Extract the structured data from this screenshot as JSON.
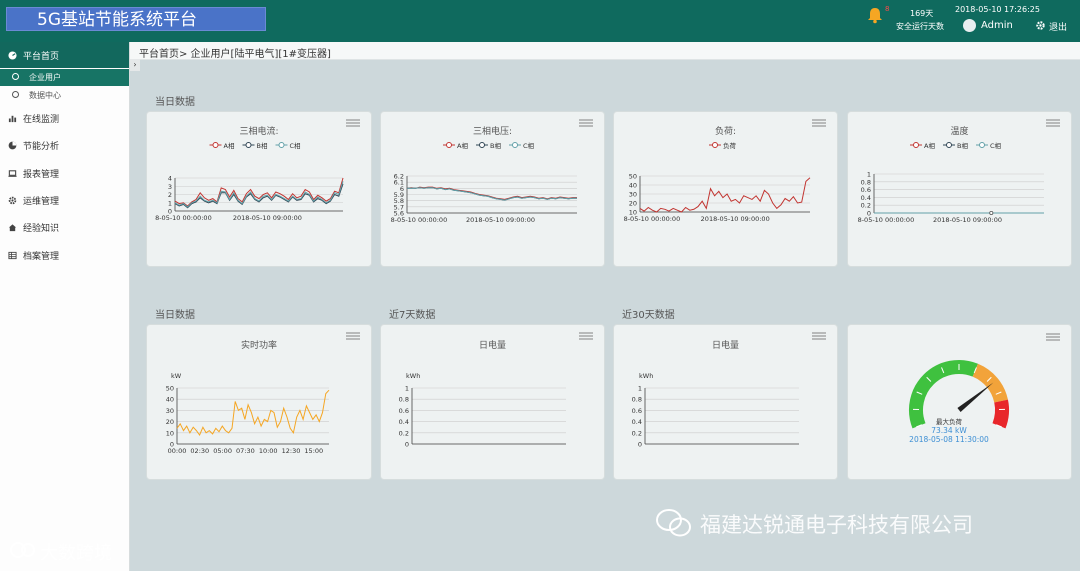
{
  "header": {
    "title": "5G基站节能系统平台",
    "alarm_count": "8",
    "days_value": "169天",
    "days_label": "安全运行天数",
    "datetime": "2018-05-10 17:26:25",
    "user": "Admin",
    "logout": "退出"
  },
  "sidebar": {
    "home": "平台首页",
    "sub_items": [
      "企业用户",
      "数据中心"
    ],
    "items": [
      "在线监测",
      "节能分析",
      "报表管理",
      "运维管理",
      "经验知识",
      "档案管理"
    ]
  },
  "breadcrumb": "平台首页> 企业用户[陆平电气][1#变压器]",
  "sections": {
    "today": "当日数据",
    "today2": "当日数据",
    "last7": "近7天数据",
    "last30": "近30天数据"
  },
  "colors": {
    "primary": "#0f6a5e",
    "red": "#c23531",
    "dark": "#2f4554",
    "teal": "#61a0a8",
    "orange": "#f5a623"
  },
  "chart_data": [
    {
      "type": "line",
      "title": "三相电流:",
      "x_tick_labels": [
        "8-05-10 00:00:00",
        "2018-05-10 09:00:00"
      ],
      "ylim": [
        0,
        4
      ],
      "y_ticks": [
        "0",
        "1",
        "2",
        "3",
        "4"
      ],
      "series": [
        {
          "name": "A相",
          "values": [
            1.2,
            0.9,
            1.0,
            0.6,
            1.1,
            1.4,
            2.2,
            1.6,
            1.3,
            1.5,
            1.1,
            2.8,
            2.6,
            1.7,
            2.5,
            1.5,
            1.1,
            2.1,
            2.6,
            1.8,
            1.5,
            2.0,
            2.2,
            1.6,
            2.3,
            2.1,
            1.8,
            1.4,
            2.1,
            1.6,
            1.8,
            2.6,
            2.3,
            1.4,
            1.9,
            1.6,
            1.2,
            1.5,
            2.4,
            2.2,
            4.4
          ]
        },
        {
          "name": "B相",
          "values": [
            0.9,
            0.6,
            0.8,
            0.4,
            0.9,
            1.1,
            1.6,
            1.2,
            1.0,
            1.2,
            0.9,
            2.2,
            2.2,
            1.3,
            2.0,
            1.2,
            0.8,
            1.7,
            2.1,
            1.4,
            1.1,
            1.6,
            1.8,
            1.3,
            1.9,
            1.7,
            1.4,
            1.1,
            1.7,
            1.3,
            1.4,
            2.1,
            1.9,
            1.1,
            1.5,
            1.3,
            0.9,
            1.2,
            2.0,
            1.8,
            3.3
          ]
        },
        {
          "name": "C相",
          "values": [
            1.0,
            0.7,
            0.9,
            0.5,
            1.0,
            1.2,
            1.8,
            1.3,
            1.1,
            1.3,
            1.0,
            2.4,
            2.3,
            1.4,
            2.2,
            1.3,
            0.9,
            1.8,
            2.3,
            1.5,
            1.2,
            1.8,
            1.9,
            1.4,
            2.0,
            1.8,
            1.5,
            1.2,
            1.8,
            1.4,
            1.5,
            2.3,
            2.0,
            1.2,
            1.7,
            1.4,
            1.0,
            1.3,
            2.2,
            2.0,
            3.6
          ]
        }
      ]
    },
    {
      "type": "line",
      "title": "三相电压:",
      "x_tick_labels": [
        "8-05-10 00:00:00",
        "2018-05-10 09:00:00"
      ],
      "ylim": [
        5.6,
        6.2
      ],
      "y_ticks": [
        "5.6",
        "5.7",
        "5.8",
        "5.9",
        "6",
        "6.1",
        "6.2"
      ],
      "series": [
        {
          "name": "A相",
          "values": [
            6.0,
            6.01,
            6.0,
            6.02,
            6.01,
            6.02,
            6.02,
            6.0,
            6.01,
            5.99,
            6.0,
            5.98,
            5.97,
            5.96,
            5.95,
            5.94,
            5.92,
            5.9,
            5.89,
            5.88,
            5.86,
            5.84,
            5.83,
            5.82,
            5.84,
            5.86,
            5.87,
            5.85,
            5.86,
            5.87,
            5.86,
            5.84,
            5.85,
            5.83,
            5.85,
            5.84,
            5.86,
            5.85,
            5.84,
            5.85,
            5.85
          ]
        },
        {
          "name": "B相",
          "values": [
            6.0,
            6.0,
            6.0,
            6.01,
            6.0,
            6.01,
            6.01,
            5.99,
            6.0,
            5.98,
            5.99,
            5.97,
            5.96,
            5.95,
            5.94,
            5.93,
            5.91,
            5.89,
            5.88,
            5.87,
            5.85,
            5.83,
            5.82,
            5.81,
            5.83,
            5.85,
            5.86,
            5.84,
            5.85,
            5.86,
            5.85,
            5.83,
            5.84,
            5.82,
            5.84,
            5.83,
            5.85,
            5.84,
            5.83,
            5.84,
            5.84
          ]
        },
        {
          "name": "C相",
          "values": [
            6.0,
            6.0,
            6.0,
            6.01,
            6.0,
            6.01,
            6.01,
            5.99,
            6.0,
            5.98,
            5.99,
            5.97,
            5.96,
            5.95,
            5.94,
            5.93,
            5.91,
            5.89,
            5.88,
            5.87,
            5.85,
            5.83,
            5.82,
            5.81,
            5.83,
            5.85,
            5.86,
            5.84,
            5.85,
            5.86,
            5.85,
            5.83,
            5.84,
            5.82,
            5.84,
            5.83,
            5.85,
            5.84,
            5.83,
            5.84,
            5.84
          ]
        }
      ]
    },
    {
      "type": "line",
      "title": "负荷:",
      "x_tick_labels": [
        "8-05-10 00:00:00",
        "2018-05-10 09:00:00"
      ],
      "ylim": [
        10,
        50
      ],
      "y_ticks": [
        "10",
        "20",
        "30",
        "40",
        "50"
      ],
      "series": [
        {
          "name": "负荷",
          "values": [
            14,
            11,
            15,
            12,
            10,
            14,
            13,
            11,
            14,
            12,
            10,
            15,
            12,
            13,
            16,
            22,
            14,
            36,
            28,
            33,
            26,
            30,
            22,
            24,
            20,
            28,
            26,
            24,
            28,
            22,
            34,
            30,
            20,
            14,
            18,
            25,
            22,
            27,
            20,
            21,
            44,
            48
          ]
        }
      ]
    },
    {
      "type": "line",
      "title": "温度",
      "x_tick_labels": [
        "8-05-10 00:00:00",
        "2018-05-10 09:00:00"
      ],
      "ylim": [
        0,
        1
      ],
      "y_ticks": [
        "0",
        "0.2",
        "0.4",
        "0.6",
        "0.8",
        "1"
      ],
      "series": [
        {
          "name": "A相",
          "values": [
            0,
            0,
            0,
            0,
            0,
            0,
            0,
            0,
            0,
            0,
            0
          ]
        },
        {
          "name": "B相",
          "values": [
            0,
            0,
            0,
            0,
            0,
            0,
            0,
            0,
            0,
            0,
            0
          ]
        },
        {
          "name": "C相",
          "values": [
            0,
            0,
            0,
            0,
            0,
            0,
            0,
            0,
            0,
            0,
            0
          ]
        }
      ]
    },
    {
      "type": "line",
      "title": "实时功率",
      "ylabel": "kW",
      "ylim": [
        0,
        50
      ],
      "y_ticks": [
        "0",
        "10",
        "20",
        "30",
        "40",
        "50"
      ],
      "x_tick_labels": [
        "00:00",
        "02:30",
        "05:00",
        "07:30",
        "10:00",
        "12:30",
        "15:00"
      ],
      "series": [
        {
          "name": "",
          "values": [
            14,
            18,
            12,
            16,
            10,
            15,
            12,
            8,
            15,
            10,
            12,
            9,
            14,
            11,
            16,
            12,
            10,
            14,
            38,
            30,
            32,
            22,
            35,
            28,
            18,
            24,
            16,
            22,
            20,
            30,
            28,
            15,
            20,
            32,
            24,
            14,
            10,
            24,
            30,
            22,
            34,
            28,
            22,
            26,
            20,
            28,
            45,
            48
          ]
        }
      ]
    },
    {
      "type": "line",
      "title": "日电量",
      "ylabel": "kWh",
      "ylim": [
        0,
        1
      ],
      "y_ticks": [
        "0",
        "0.2",
        "0.4",
        "0.6",
        "0.8",
        "1"
      ],
      "series": []
    },
    {
      "type": "line",
      "title": "日电量",
      "ylabel": "kWh",
      "ylim": [
        0,
        1
      ],
      "y_ticks": [
        "0",
        "0.2",
        "0.4",
        "0.6",
        "0.8",
        "1"
      ],
      "series": []
    }
  ],
  "gauge": {
    "label": "最大负荷",
    "value": "73.34 kW",
    "value_fraction": 0.73,
    "time": "2018-05-08 11:30:00"
  },
  "watermarks": {
    "left": "大数跨境",
    "right": "福建达锐通电子科技有限公司"
  }
}
